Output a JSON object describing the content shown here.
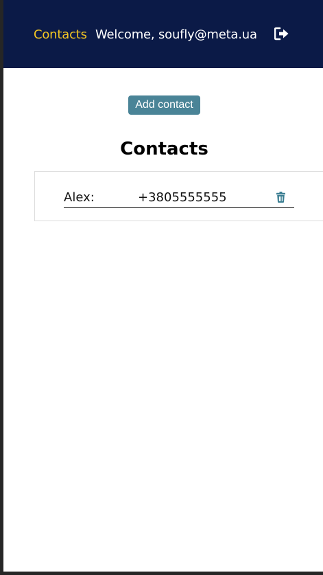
{
  "header": {
    "nav_link": "Contacts",
    "welcome_text": "Welcome, soufly@meta.ua",
    "logout_icon": "logout-icon",
    "nav_link_color": "#f3c623",
    "background": "#0b1a47"
  },
  "main": {
    "add_button_label": "Add contact",
    "add_button_color": "#4a8497",
    "title": "Contacts",
    "contacts": [
      {
        "name": "Alex:",
        "phone": "+3805555555",
        "delete_icon": "trash-icon"
      }
    ]
  }
}
